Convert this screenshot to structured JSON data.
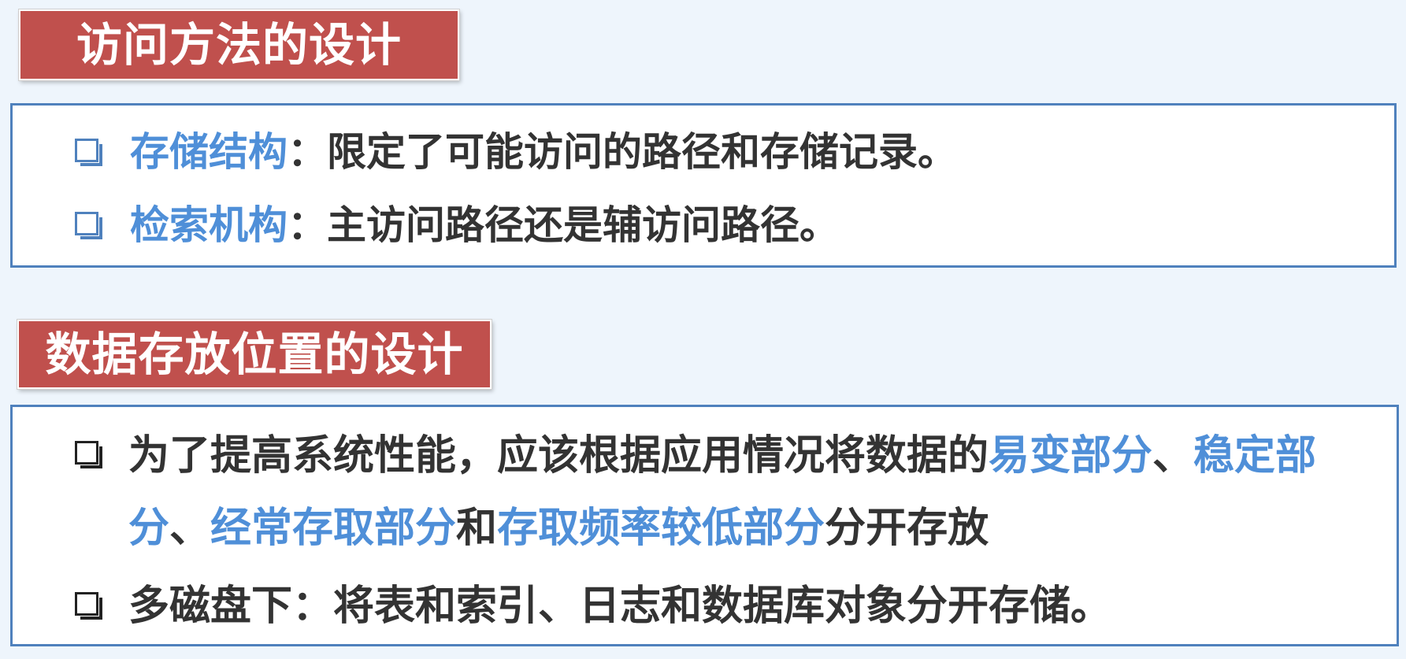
{
  "section1": {
    "title": "访问方法的设计",
    "items": [
      {
        "key": "存储结构",
        "sep": "：",
        "text": "限定了可能访问的路径和存储记录。"
      },
      {
        "key": "检索机构",
        "sep": "：",
        "text": "主访问路径还是辅访问路径。"
      }
    ]
  },
  "section2": {
    "title": "数据存放位置的设计",
    "item1": {
      "line1_a": "为了提高系统性能，应该根据应用情况将数据的",
      "line1_b": "易变部分",
      "line1_c": "、",
      "line1_d": "稳定部",
      "line2_a": "分",
      "line2_b": "、",
      "line2_c": "经常存取部分",
      "line2_d": "和",
      "line2_e": "存取频率较低部分",
      "line2_f": "分开存放"
    },
    "item2": {
      "text": "多磁盘下：将表和索引、日志和数据库对象分开存储。"
    }
  },
  "colors": {
    "banner": "#c0504d",
    "border": "#4f81bd",
    "highlight": "#4f8fd8",
    "text": "#333333",
    "background": "#eef5fc"
  }
}
